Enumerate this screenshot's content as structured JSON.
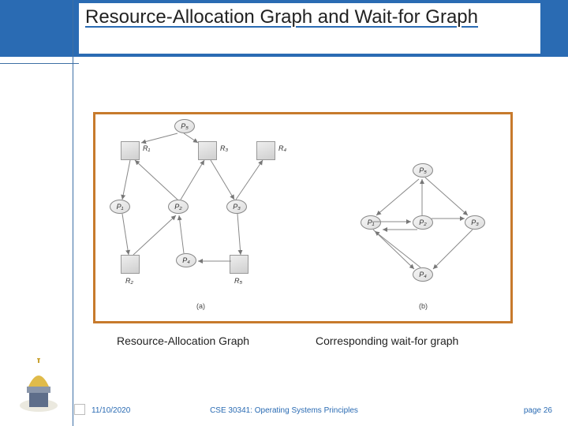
{
  "slide": {
    "title": "Resource-Allocation Graph and Wait-for Graph",
    "caption_left": "Resource-Allocation Graph",
    "caption_right": "Corresponding wait-for graph",
    "footer_date": "11/10/2020",
    "footer_course": "CSE 30341: Operating Systems Principles",
    "footer_page_label": "page",
    "footer_page_num": "26"
  },
  "figure": {
    "panel_a_label": "(a)",
    "panel_b_label": "(b)",
    "processes": {
      "p1": "P₁",
      "p2": "P₂",
      "p3": "P₃",
      "p4": "P₄",
      "p5": "P₅"
    },
    "resources": {
      "r1": "R₁",
      "r2": "R₂",
      "r3": "R₃",
      "r4": "R₄",
      "r5": "R₅"
    }
  }
}
